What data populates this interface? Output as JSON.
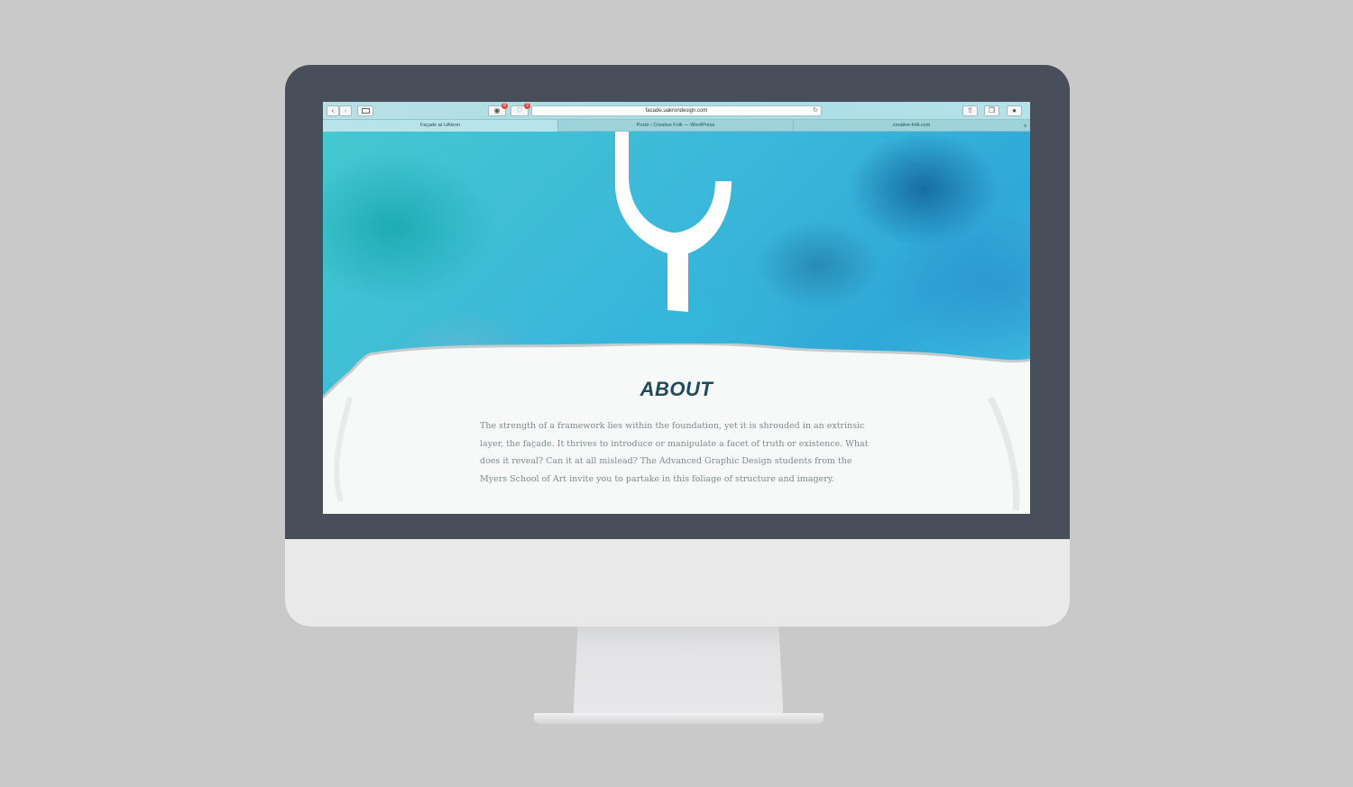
{
  "browser": {
    "url": "facade.uakrondesign.com",
    "badge_left": "8",
    "badge_right": "3",
    "back_icon": "chevron-left-icon",
    "forward_icon": "chevron-right-icon",
    "sidebar_icon": "sidebar-icon",
    "reload_icon": "reload-icon",
    "share_icon": "share-icon",
    "tabs_icon": "tabs-icon",
    "download_icon": "download-icon",
    "tabs": [
      {
        "label": "Façade at UAkron"
      },
      {
        "label": "Posts ‹ Creative Folk — WordPress"
      },
      {
        "label": "creative-folk.com"
      }
    ],
    "add_tab": "+"
  },
  "page": {
    "heading": "ABOUT",
    "body": "The strength of a framework lies within the foundation, yet it is shrouded in an extrinsic layer, the façade. It thrives to introduce or manipulate a facet of truth or existence. What does it reveal? Can it at all mislead? The Advanced Graphic Design students from the Myers School of Art invite you to partake in this foliage of structure and imagery.",
    "colors": {
      "heading": "#1f4a59",
      "body_text": "#7d8b8f",
      "watercolor": "#3bb8da"
    }
  }
}
